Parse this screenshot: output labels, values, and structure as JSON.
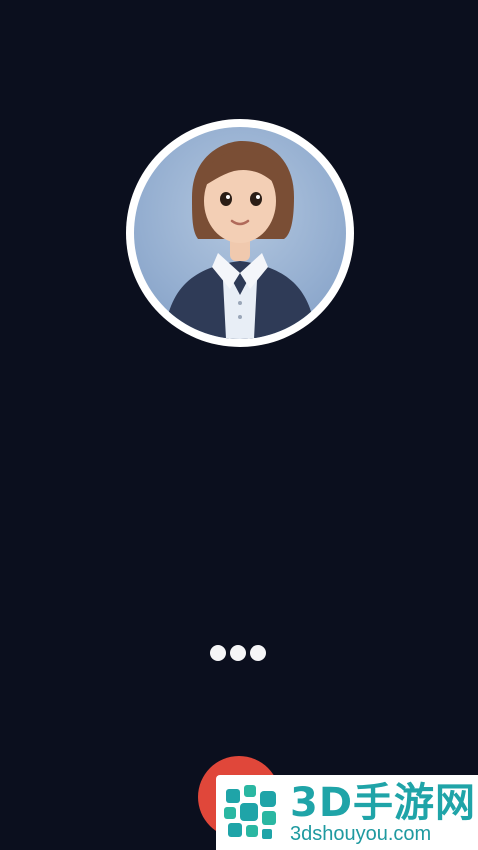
{
  "call": {
    "avatar_icon": "person-avatar",
    "status_indicator": "typing-dots",
    "hangup_icon": "hangup-button",
    "hangup_color": "#e0473a",
    "background_color": "#0b0f1e"
  },
  "watermark": {
    "title": "3D手游网",
    "url": "3dshouyou.com",
    "color": "#1fa4a8"
  }
}
